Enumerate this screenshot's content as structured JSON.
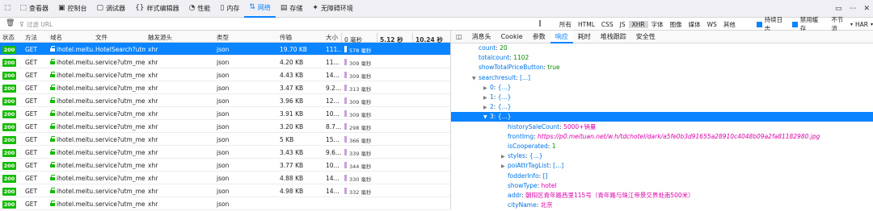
{
  "toolbar": {
    "tabs": [
      {
        "label": "查看器",
        "icon": "inspector-icon",
        "glyph": "⬚"
      },
      {
        "label": "控制台",
        "icon": "console-icon",
        "glyph": "▣"
      },
      {
        "label": "调试器",
        "icon": "debugger-icon",
        "glyph": "▢"
      },
      {
        "label": "样式编辑器",
        "icon": "style-editor-icon",
        "glyph": "{}"
      },
      {
        "label": "性能",
        "icon": "performance-icon",
        "glyph": "◔"
      },
      {
        "label": "内存",
        "icon": "memory-icon",
        "glyph": "▯"
      },
      {
        "label": "网络",
        "icon": "network-icon",
        "glyph": "⇅"
      },
      {
        "label": "存储",
        "icon": "storage-icon",
        "glyph": "▤"
      },
      {
        "label": "无障碍环境",
        "icon": "accessibility-icon",
        "glyph": "✦"
      }
    ],
    "active_index": 6
  },
  "filter": {
    "placeholder": "过滤 URL",
    "types": [
      "所有",
      "HTML",
      "CSS",
      "JS",
      "XHR",
      "字体",
      "图像",
      "媒体",
      "WS",
      "其他"
    ],
    "selected_type": "XHR",
    "persist_logs": "持续日志",
    "disable_cache": "禁用缓存",
    "throttle": "不节流",
    "har": "HAR"
  },
  "columns": {
    "status": "状态",
    "method": "方法",
    "domain": "域名",
    "file": "文件",
    "cause": "触发源头",
    "type": "类型",
    "transferred": "传输",
    "size": "大小",
    "timeline_0": "0 毫秒",
    "timeline_1": "5.12 秒",
    "timeline_2": "10.24 秒"
  },
  "rows": [
    {
      "status": "200",
      "method": "GET",
      "domain": "ihotel.meitu...",
      "file": "HotelSearch?utm...",
      "cause": "xhr",
      "type": "json",
      "transferred": "19.70 KB",
      "size": "111...",
      "time": "578 毫秒",
      "selected": true
    },
    {
      "status": "200",
      "method": "GET",
      "domain": "ihotel.meitu...",
      "file": "service?utm_med...",
      "cause": "xhr",
      "type": "json",
      "transferred": "4.20 KB",
      "size": "11...",
      "time": "309 毫秒"
    },
    {
      "status": "200",
      "method": "GET",
      "domain": "ihotel.meitu...",
      "file": "service?utm_med...",
      "cause": "xhr",
      "type": "json",
      "transferred": "4.43 KB",
      "size": "14...",
      "time": "309 毫秒"
    },
    {
      "status": "200",
      "method": "GET",
      "domain": "ihotel.meitu...",
      "file": "service?utm_med...",
      "cause": "xhr",
      "type": "json",
      "transferred": "3.47 KB",
      "size": "9.2...",
      "time": "313 毫秒"
    },
    {
      "status": "200",
      "method": "GET",
      "domain": "ihotel.meitu...",
      "file": "service?utm_med...",
      "cause": "xhr",
      "type": "json",
      "transferred": "3.96 KB",
      "size": "12...",
      "time": "309 毫秒"
    },
    {
      "status": "200",
      "method": "GET",
      "domain": "ihotel.meitu...",
      "file": "service?utm_med...",
      "cause": "xhr",
      "type": "json",
      "transferred": "3.91 KB",
      "size": "10...",
      "time": "309 毫秒"
    },
    {
      "status": "200",
      "method": "GET",
      "domain": "ihotel.meitu...",
      "file": "service?utm_med...",
      "cause": "xhr",
      "type": "json",
      "transferred": "3.20 KB",
      "size": "8.7...",
      "time": "298 毫秒"
    },
    {
      "status": "200",
      "method": "GET",
      "domain": "ihotel.meitu...",
      "file": "service?utm_med...",
      "cause": "xhr",
      "type": "json",
      "transferred": "5 KB",
      "size": "15...",
      "time": "366 毫秒"
    },
    {
      "status": "200",
      "method": "GET",
      "domain": "ihotel.meitu...",
      "file": "service?utm_med...",
      "cause": "xhr",
      "type": "json",
      "transferred": "3.43 KB",
      "size": "9.6...",
      "time": "339 毫秒"
    },
    {
      "status": "200",
      "method": "GET",
      "domain": "ihotel.meitu...",
      "file": "service?utm_med...",
      "cause": "xhr",
      "type": "json",
      "transferred": "3.77 KB",
      "size": "10...",
      "time": "344 毫秒"
    },
    {
      "status": "200",
      "method": "GET",
      "domain": "ihotel.meitu...",
      "file": "service?utm_med...",
      "cause": "xhr",
      "type": "json",
      "transferred": "4.88 KB",
      "size": "14...",
      "time": "330 毫秒"
    },
    {
      "status": "200",
      "method": "GET",
      "domain": "ihotel.meitu...",
      "file": "service?utm_med...",
      "cause": "xhr",
      "type": "json",
      "transferred": "4.98 KB",
      "size": "14...",
      "time": "332 毫秒"
    },
    {
      "status": "200",
      "method": "GET",
      "domain": "ihotel.meitu...",
      "file": "service?utm_med...",
      "cause": "xhr",
      "type": "json",
      "transferred": "",
      "size": "",
      "time": ""
    }
  ],
  "detail": {
    "tabs": [
      "消息头",
      "Cookie",
      "参数",
      "响应",
      "耗时",
      "堆栈跟踪",
      "安全性"
    ],
    "active_tab": "响应",
    "tree": [
      {
        "key": "count",
        "value": "20",
        "vclass": "num",
        "indent": 0,
        "twisty": ""
      },
      {
        "key": "totalcount",
        "value": "1102",
        "vclass": "num",
        "indent": 0,
        "twisty": ""
      },
      {
        "key": "showTotalPriceButton",
        "value": "true",
        "vclass": "num",
        "indent": 0,
        "twisty": ""
      },
      {
        "key": "searchresult",
        "value": "[...]",
        "vclass": "k",
        "indent": 0,
        "twisty": "▼"
      },
      {
        "key": "0",
        "value": "{...}",
        "vclass": "k",
        "indent": 1,
        "twisty": "▶"
      },
      {
        "key": "1",
        "value": "{...}",
        "vclass": "k",
        "indent": 1,
        "twisty": "▶"
      },
      {
        "key": "2",
        "value": "{...}",
        "vclass": "k",
        "indent": 1,
        "twisty": "▶"
      },
      {
        "key": "3",
        "value": "{...}",
        "vclass": "k",
        "indent": 1,
        "twisty": "▼",
        "selected": true
      },
      {
        "key": "historySaleCount",
        "value": "5000+销量",
        "vclass": "str",
        "indent": 2,
        "twisty": ""
      },
      {
        "key": "frontImg",
        "value": "https://p0.meituan.net/w.h/tdchotel/dark/a5fe0b3d91655a28910c4048b09a2fa81182980.jpg",
        "vclass": "url",
        "indent": 2,
        "twisty": ""
      },
      {
        "key": "isCooperated",
        "value": "1",
        "vclass": "num",
        "indent": 2,
        "twisty": ""
      },
      {
        "key": "styles",
        "value": "{...}",
        "vclass": "k",
        "indent": 2,
        "twisty": "▶"
      },
      {
        "key": "poiAttrTagList",
        "value": "[...]",
        "vclass": "k",
        "indent": 2,
        "twisty": "▶"
      },
      {
        "key": "fodderInfo",
        "value": "[]",
        "vclass": "k",
        "indent": 2,
        "twisty": ""
      },
      {
        "key": "showType",
        "value": "hotel",
        "vclass": "str",
        "indent": 2,
        "twisty": ""
      },
      {
        "key": "addr",
        "value": "朝阳区青年路西里115号（青年路与珠江帝景交界处南500米）",
        "vclass": "str",
        "indent": 2,
        "twisty": ""
      },
      {
        "key": "cityName",
        "value": "北京",
        "vclass": "str",
        "indent": 2,
        "twisty": ""
      }
    ]
  }
}
